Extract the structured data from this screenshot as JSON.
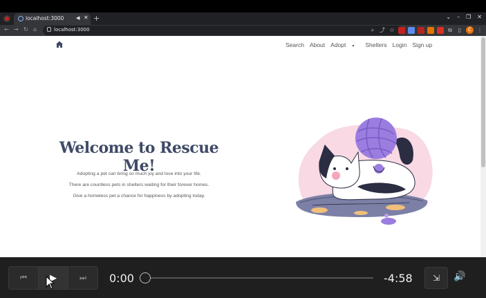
{
  "browser": {
    "tab_title": "localhost:3000",
    "url": "localhost:3000",
    "new_tab_symbol": "+",
    "tab_close_symbol": "✕",
    "accent": "#8ab4f8"
  },
  "site": {
    "nav": [
      {
        "label": "Search"
      },
      {
        "label": "About"
      },
      {
        "label": "Adopt"
      },
      {
        "label": "Shelters"
      },
      {
        "label": "Login"
      },
      {
        "label": "Sign up"
      }
    ],
    "hero": {
      "title": "Welcome to Rescue Me!",
      "lines": [
        "Adopting a pet can bring so much joy and love into your life.",
        "There are countless pets in shelters waiting for their forever homes.",
        "Give a homeless pet a chance for happiness by adopting today."
      ]
    },
    "illustration": "cat-with-yarn-illustration",
    "title_color": "#3f4a66"
  },
  "player": {
    "current_time": "0:00",
    "remaining_time": "-4:58",
    "progress_fraction": 0,
    "icons": {
      "prev": "skip-back-icon",
      "play": "play-icon",
      "next": "skip-forward-icon",
      "pip": "picture-in-picture-icon",
      "volume": "volume-icon"
    }
  }
}
